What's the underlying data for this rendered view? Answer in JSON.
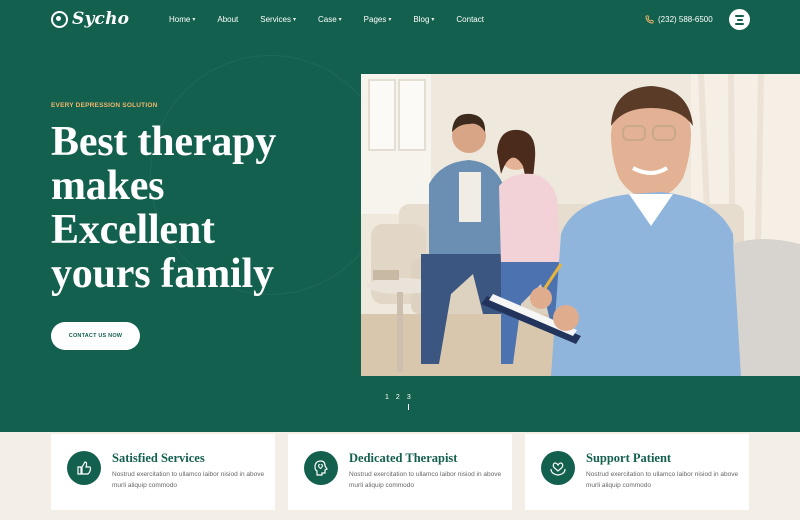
{
  "brand": {
    "name": "Sycho"
  },
  "nav": {
    "items": [
      {
        "label": "Home",
        "has_dropdown": true
      },
      {
        "label": "About",
        "has_dropdown": false
      },
      {
        "label": "Services",
        "has_dropdown": true
      },
      {
        "label": "Case",
        "has_dropdown": true
      },
      {
        "label": "Pages",
        "has_dropdown": true
      },
      {
        "label": "Blog",
        "has_dropdown": true
      },
      {
        "label": "Contact",
        "has_dropdown": false
      }
    ]
  },
  "header": {
    "phone": "(232) 588-6500",
    "phone_icon": "phone-icon",
    "menu_icon": "hamburger-icon"
  },
  "hero": {
    "tagline": "EVERY DEPRESSION SOLUTION",
    "headline_lines": [
      "Best therapy",
      "makes",
      "Excellent",
      "yours family"
    ],
    "cta_label": "CONTACT US NOW",
    "image_alt": "Therapist with clipboard smiling in front of a couple on a sofa"
  },
  "slider": {
    "pages": [
      "1",
      "2",
      "3"
    ],
    "active": "3"
  },
  "features": [
    {
      "title": "Satisfied Services",
      "text": "Nostrud exercitation to ullamco laibor nisiod in above murli aliquip commodo",
      "icon": "thumbs-up-icon"
    },
    {
      "title": "Dedicated Therapist",
      "text": "Nostrud exercitation to ullamco laibor nisiod in above murli aliquip commodo",
      "icon": "brain-heart-icon"
    },
    {
      "title": "Support Patient",
      "text": "Nostrud exercitation to ullamco laibor nisiod in above murli aliquip commodo",
      "icon": "heart-hands-icon"
    }
  ],
  "colors": {
    "primary": "#14604f",
    "accent": "#f0b76a",
    "background": "#f3efe7",
    "card": "#ffffff"
  }
}
